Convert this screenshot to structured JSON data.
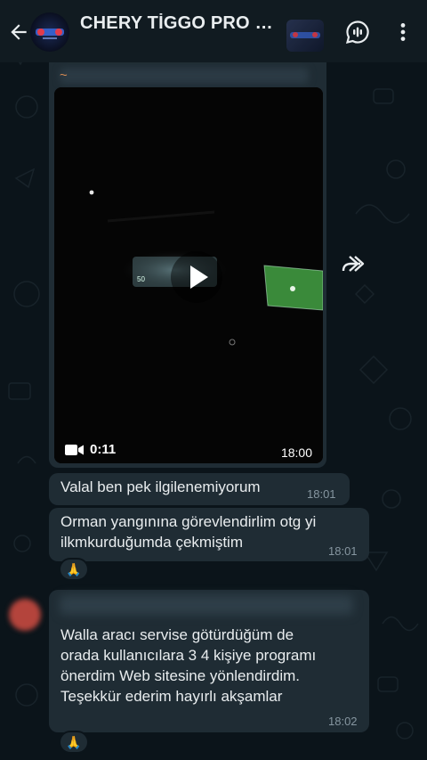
{
  "header": {
    "title": "CHERY TİGGO PRO M..."
  },
  "video_message": {
    "prefix": "~",
    "duration": "0:11",
    "time": "18:00"
  },
  "messages": [
    {
      "text": "Valal ben pek ilgilenemiyorum",
      "time": "18:01"
    },
    {
      "text_lines": [
        "Orman yangınına görevlendirlim otg yi",
        "ilkmkurduğumda çekmiştim"
      ],
      "time": "18:01",
      "reaction": "🙏"
    },
    {
      "text_lines": [
        "Walla aracı servise götürdüğüm de",
        "orada kullanıcılara 3 4 kişiye programı",
        "önerdim Web sitesine yönlendirdim.",
        "Teşekkür ederim hayırlı akşamlar"
      ],
      "time": "18:02",
      "reaction": "🙏"
    }
  ],
  "colors": {
    "background": "#0b141a",
    "header": "#111b21",
    "bubble": "#1f2c34",
    "timestamp": "#8696a0"
  },
  "icons": [
    "back-arrow-icon",
    "group-avatar",
    "voice-call-icon",
    "more-options-icon",
    "forward-icon",
    "play-icon",
    "video-camera-icon"
  ]
}
